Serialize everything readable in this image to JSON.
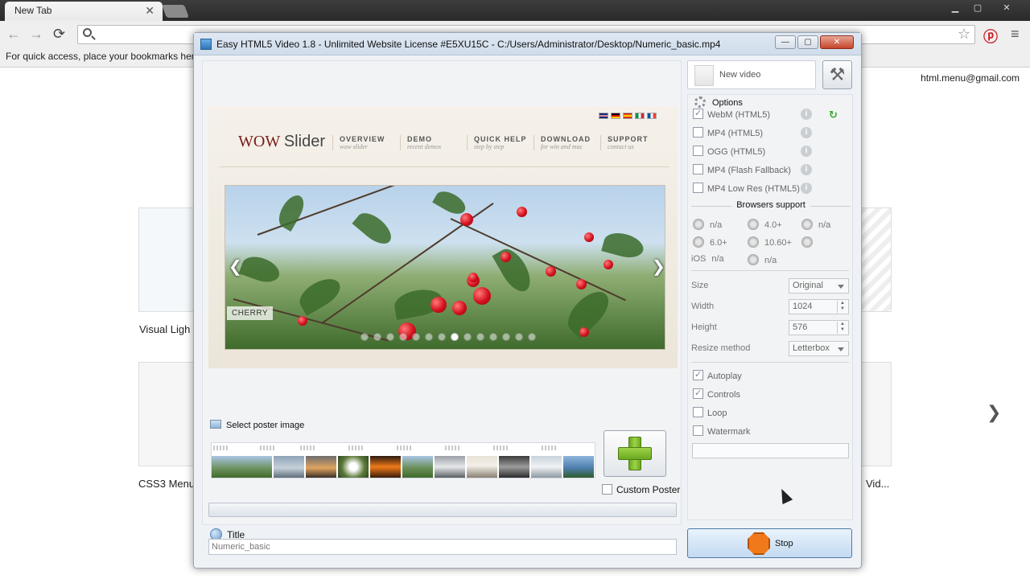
{
  "browser": {
    "tab_title": "New Tab",
    "tab_close": "✕",
    "bookmarks_hint": "For quick access, place your bookmarks here",
    "account_email": "html.menu@gmail.com",
    "thumb_labels": [
      "Visual Ligh",
      "CSS3 Menu",
      "Vid..."
    ],
    "next_arrow": "❯"
  },
  "window": {
    "title": "Easy HTML5 Video 1.8  - Unlimited Website License #E5XU15C - C:/Users/Administrator/Desktop/Numeric_basic.mp4",
    "btn_minimize": "—",
    "btn_maximize": "▢",
    "btn_close": "✕"
  },
  "preview": {
    "logo_wow": "WOW",
    "logo_slider": "Slider",
    "nav": [
      {
        "title": "OVERVIEW",
        "sub": "wow slider"
      },
      {
        "title": "DEMO",
        "sub": "recent demos"
      },
      {
        "title": "QUICK HELP",
        "sub": "step by step"
      },
      {
        "title": "DOWNLOAD",
        "sub": "for win and mac"
      },
      {
        "title": "SUPPORT",
        "sub": "contact us"
      }
    ],
    "caption": "CHERRY",
    "arrow_prev": "❮",
    "arrow_next": "❯"
  },
  "poster": {
    "select_label": "Select poster image",
    "custom_poster_label": "Custom Poster"
  },
  "title_field": {
    "label": "Title",
    "value": "Numeric_basic"
  },
  "toolbar": {
    "new_video_label": "New video"
  },
  "options": {
    "heading": "Options",
    "formats": [
      {
        "label": "WebM (HTML5)",
        "checked": true
      },
      {
        "label": "MP4 (HTML5)",
        "checked": false
      },
      {
        "label": "OGG (HTML5)",
        "checked": false
      },
      {
        "label": "MP4 (Flash Fallback)",
        "checked": false
      },
      {
        "label": "MP4 Low Res (HTML5)",
        "checked": false
      }
    ],
    "browsers_title": "Browsers support",
    "browsers": [
      "n/a",
      "4.0+",
      "n/a",
      "6.0+",
      "10.60+",
      "",
      "iOS",
      "n/a",
      "n/a"
    ],
    "size_label": "Size",
    "size_value": "Original",
    "width_label": "Width",
    "width_value": "1024",
    "height_label": "Height",
    "height_value": "576",
    "resize_label": "Resize method",
    "resize_value": "Letterbox",
    "playback": [
      {
        "label": "Autoplay",
        "checked": true
      },
      {
        "label": "Controls",
        "checked": true
      },
      {
        "label": "Loop",
        "checked": false
      },
      {
        "label": "Watermark",
        "checked": false
      }
    ]
  },
  "actions": {
    "stop_label": "Stop"
  }
}
